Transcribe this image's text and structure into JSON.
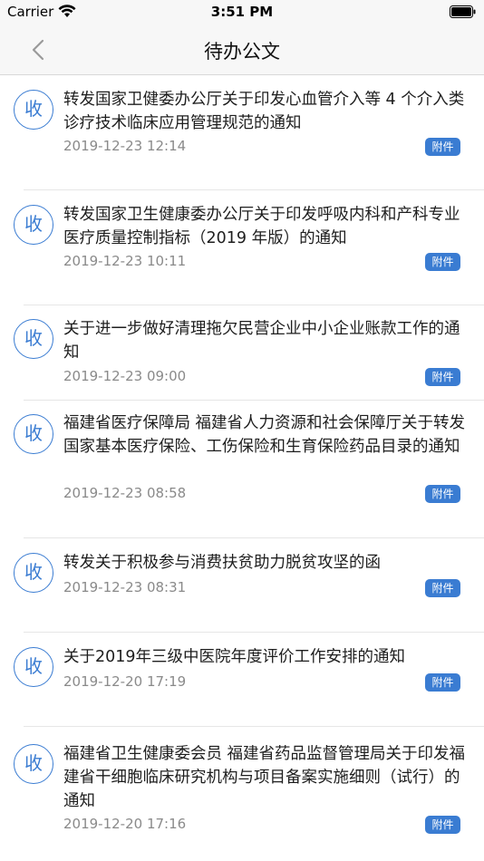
{
  "status_bar": {
    "carrier": "Carrier",
    "time": "3:51 PM"
  },
  "nav": {
    "title": "待办公文"
  },
  "items": [
    {
      "badge": "收",
      "title": "转发国家卫健委办公厅关于印发心血管介入等 4 个介入类诊疗技术临床应用管理规范的通知",
      "date": "2019-12-23 12:14",
      "attachment": "附件"
    },
    {
      "badge": "收",
      "title": "转发国家卫生健康委办公厅关于印发呼吸内科和产科专业医疗质量控制指标（2019 年版）的通知",
      "date": "2019-12-23 10:11",
      "attachment": "附件"
    },
    {
      "badge": "收",
      "title": "关于进一步做好清理拖欠民营企业中小企业账款工作的通知",
      "date": "2019-12-23 09:00",
      "attachment": "附件"
    },
    {
      "badge": "收",
      "title": "福建省医疗保障局 福建省人力资源和社会保障厅关于转发国家基本医疗保险、工伤保险和生育保险药品目录的通知",
      "date": "2019-12-23 08:58",
      "attachment": "附件"
    },
    {
      "badge": "收",
      "title": "转发关于积极参与消费扶贫助力脱贫攻坚的函",
      "date": "2019-12-23 08:31",
      "attachment": "附件"
    },
    {
      "badge": "收",
      "title": "关于2019年三级中医院年度评价工作安排的通知",
      "date": "2019-12-20 17:19",
      "attachment": "附件"
    },
    {
      "badge": "收",
      "title": "福建省卫生健康委会员 福建省药品监督管理局关于印发福建省干细胞临床研究机构与项目备案实施细则（试行）的通知",
      "date": "2019-12-20 17:16",
      "attachment": "附件"
    }
  ]
}
